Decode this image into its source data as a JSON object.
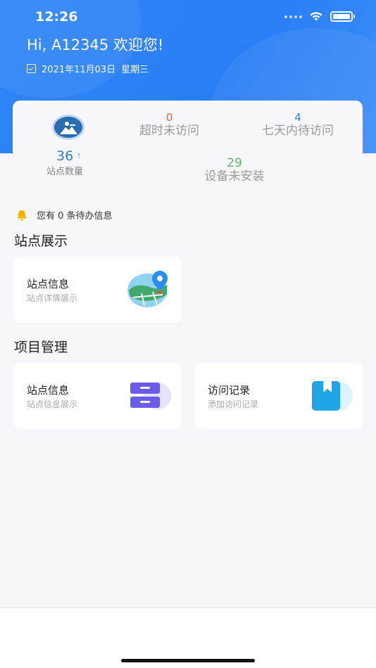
{
  "status_bar": {
    "time": "12:26"
  },
  "header": {
    "greeting": "Hi, A12345 欢迎您!",
    "date": "2021年11月03日",
    "weekday": "星期三"
  },
  "stats": {
    "site_count": "36",
    "site_count_label": "站点数量",
    "overtime_value": "0",
    "overtime_label": "超时未访问",
    "week_value": "4",
    "week_label": "七天内待访问",
    "uninstalled_value": "29",
    "uninstalled_label": "设备未安装"
  },
  "notice": {
    "text": "您有 0 条待办信息"
  },
  "site_display": {
    "title": "站点展示",
    "card": {
      "title": "站点信息",
      "subtitle": "站点详情展示",
      "icon": "map-pin-icon"
    }
  },
  "project_mgmt": {
    "title": "项目管理",
    "cards": [
      {
        "title": "站点信息",
        "subtitle": "站点信息展示",
        "icon": "server-icon"
      },
      {
        "title": "访问记录",
        "subtitle": "添加访问记录",
        "icon": "bookmark-icon"
      }
    ]
  },
  "colors": {
    "header_blue": "#2a7ef5",
    "overtime_orange": "#f0642e",
    "stat_blue": "#3a7bd5",
    "uninstalled_green": "#60b86a"
  }
}
